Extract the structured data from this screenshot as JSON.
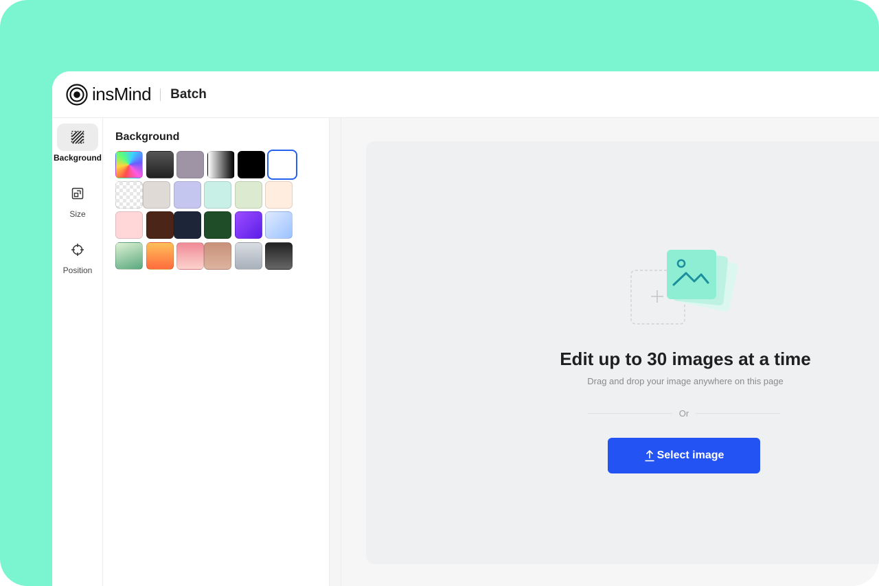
{
  "app": {
    "logo_text": "insMind",
    "title": "Batch"
  },
  "rail": {
    "items": [
      {
        "label": "Background",
        "icon": "background-stripes-icon",
        "active": true
      },
      {
        "label": "Size",
        "icon": "resize-icon",
        "active": false
      },
      {
        "label": "Position",
        "icon": "crosshair-icon",
        "active": false
      }
    ]
  },
  "panel": {
    "title": "Background",
    "selected_swatch": "white",
    "swatches": [
      [
        "rainbow-gradient",
        "dark-gray-gradient",
        "mauve-gray",
        "white-black-gradient",
        "black",
        "white"
      ],
      [
        "transparent",
        "warm-gray",
        "lavender",
        "mint",
        "sage",
        "cream"
      ],
      [
        "light-pink",
        "brown",
        "navy",
        "forest-green",
        "purple-gradient",
        "sky-blue-gradient"
      ],
      [
        "green-gradient",
        "orange-gradient",
        "pink-gradient",
        "tan-gradient",
        "silver-gradient",
        "charcoal-gradient"
      ]
    ]
  },
  "workspace": {
    "headline": "Edit up to 30 images at a time",
    "subtext": "Drag and drop your image anywhere on this page",
    "divider_text": "Or",
    "select_button_label": "Select image",
    "upload_icon": "upload-arrow-icon",
    "illustration_icon": "image-add-icon"
  },
  "colors": {
    "frame_bg": "#7af5cf",
    "accent_blue": "#2354f3",
    "selected_border": "#2660ee",
    "dropzone_bg": "#eff0f2"
  }
}
